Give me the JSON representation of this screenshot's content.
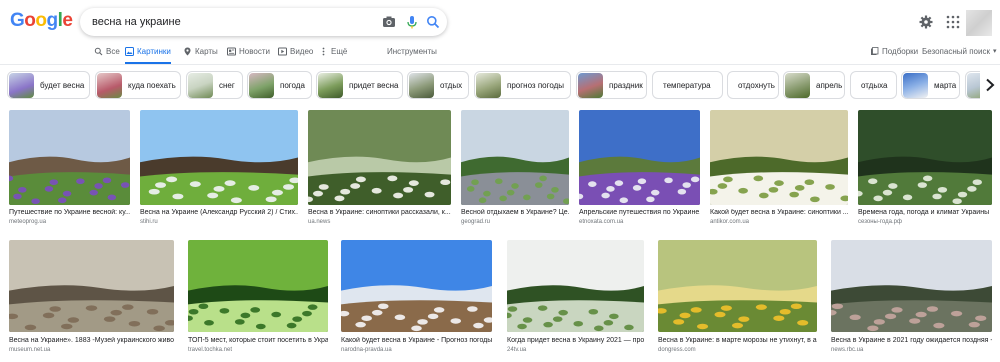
{
  "logo": {
    "letters": [
      "G",
      "o",
      "o",
      "g",
      "l",
      "e"
    ],
    "colors": [
      "#4285f4",
      "#ea4335",
      "#fbbc05",
      "#4285f4",
      "#34a853",
      "#ea4335"
    ]
  },
  "search": {
    "value": "весна на украине"
  },
  "tabs": [
    {
      "label": "Все",
      "icon": "search-icon",
      "active": false
    },
    {
      "label": "Картинки",
      "icon": "image-icon",
      "active": true
    },
    {
      "label": "Карты",
      "icon": "map-pin-icon",
      "active": false
    },
    {
      "label": "Новости",
      "icon": "news-icon",
      "active": false
    },
    {
      "label": "Видео",
      "icon": "video-icon",
      "active": false
    },
    {
      "label": "Ещё",
      "icon": "more-icon",
      "active": false
    },
    {
      "label": "Инструменты",
      "icon": "",
      "active": false
    }
  ],
  "right_links": {
    "collections": "Подборки",
    "safe_search": "Безопасный поиск"
  },
  "chips": [
    {
      "label": "будет весна",
      "thumb": "#9c8fd0"
    },
    {
      "label": "куда поехать",
      "thumb": "#b85a6a"
    },
    {
      "label": "снег",
      "thumb": "#c9d4c2"
    },
    {
      "label": "погода",
      "thumb": "#7fa36a"
    },
    {
      "label": "придет весна",
      "thumb": "#7d9d5c"
    },
    {
      "label": "отдых",
      "thumb": "#8c9a79"
    },
    {
      "label": "прогноз погоды",
      "thumb": "#9aa77c"
    },
    {
      "label": "праздник",
      "thumb": "#b76f73"
    },
    {
      "label": "температура",
      "thumb": ""
    },
    {
      "label": "отдохнуть",
      "thumb": ""
    },
    {
      "label": "апрель",
      "thumb": "#8a9c70"
    },
    {
      "label": "отдыха",
      "thumb": ""
    },
    {
      "label": "марта",
      "thumb": "#3a6ec6"
    },
    {
      "label": "",
      "thumb": "#b9c7d4"
    }
  ],
  "results": [
    {
      "title": "Путешествие по Украине весной: ку...",
      "source": "meteoprog.ua",
      "palette": [
        "#b7c9e0",
        "#7b4dc2",
        "#5a8c3a",
        "#6e5a46"
      ]
    },
    {
      "title": "Весна на Украине (Александр Русский 2) / Стих...",
      "source": "stihi.ru",
      "palette": [
        "#8fc4f0",
        "#f2f4f6",
        "#6fae3c",
        "#4a3b2c"
      ]
    },
    {
      "title": "Весна в Украине: синоптики рассказали, к...",
      "source": "ua.news",
      "palette": [
        "#6f8a55",
        "#f7f7f2",
        "#3f5e2a",
        "#b9c9a7"
      ]
    },
    {
      "title": "Весной отдыхаем в Украине? Це...",
      "source": "geograd.ru",
      "palette": [
        "#c9d6e2",
        "#6fa24a",
        "#8a8f97",
        "#3f6a30"
      ]
    },
    {
      "title": "Апрельские путешествия по Украине...",
      "source": "etnoxata.com.ua",
      "palette": [
        "#3e6fc8",
        "#f0f2f5",
        "#7a4fb4",
        "#5c7a3c"
      ]
    },
    {
      "title": "Какой будет весна в Украине: синоптики ...",
      "source": "antikor.com.ua",
      "palette": [
        "#d4cfa8",
        "#7a9a3e",
        "#f4f3ea",
        "#4d6a2a"
      ]
    },
    {
      "title": "Времена года, погода и климат Украины",
      "source": "сезоны-года.рф",
      "palette": [
        "#2f4e2a",
        "#e9efe2",
        "#517a3a",
        "#1f331c"
      ]
    },
    {
      "title": "Весна на Украине». 1883 -Музей украинского живо...",
      "source": "museum.net.ua",
      "palette": [
        "#c8c2b4",
        "#7d6a55",
        "#a29a86",
        "#5e5446"
      ]
    },
    {
      "title": "ТОП-5 мест, которые стоит посетить в Украине...",
      "source": "travel.tochka.net",
      "palette": [
        "#6fb23c",
        "#2f6d1f",
        "#b9e08a",
        "#1e4a16"
      ]
    },
    {
      "title": "Какой будет весна в Украине - Прогноз погоды...",
      "source": "narodna-pravda.ua",
      "palette": [
        "#3f86e6",
        "#f6f6f8",
        "#8a6a4a",
        "#dfe6ef"
      ]
    },
    {
      "title": "Когда придет весна в Украину 2021 — прогно...",
      "source": "24tv.ua",
      "palette": [
        "#eef0ee",
        "#5c8a3c",
        "#c9d6c0",
        "#2f5224"
      ]
    },
    {
      "title": "Весна в Украине: в марте морозы не утихнут, в ап...",
      "source": "dongress.com",
      "palette": [
        "#b8c47e",
        "#f2c12a",
        "#6a8a34",
        "#e5d98a"
      ]
    },
    {
      "title": "Весна в Украине в 2021 году ожидается поздняя -...",
      "source": "news.rbc.ua",
      "palette": [
        "#d9dee6",
        "#c7a6a0",
        "#6b7360",
        "#3d4a36"
      ]
    }
  ]
}
